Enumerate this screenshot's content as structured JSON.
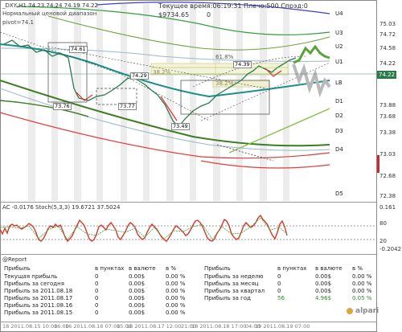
{
  "header": {
    "symbol_line": "_DXY,H1  74.23 74.24 74.19 74.22",
    "indicator_title": "Нормальный ценовой диапазон",
    "pivot_label": "pivot=74.1",
    "time_label": "Текущее время:06:19:31 Плечо:500  Спрэд:0",
    "balance": "$9734.65",
    "zero": "0"
  },
  "levels": {
    "right_codes": [
      "U4",
      "U3",
      "U2",
      "U1",
      "LB",
      "D1",
      "D2",
      "D3",
      "D4",
      "D5"
    ],
    "fib_618": "61.8%",
    "fib_382a": "38.2%",
    "fib_382b": "38.2%"
  },
  "price_axis": {
    "ticks": [
      "75.03",
      "74.72",
      "74.58",
      "74.22",
      "73.88",
      "73.68",
      "73.38",
      "73.03",
      "72.68",
      "72.38"
    ],
    "current_price": "74.22",
    "current_color": "#2b7a4b"
  },
  "annotations": {
    "labels": [
      "74.61",
      "73.76",
      "74.29",
      "73.77",
      "73.49",
      "74.39"
    ]
  },
  "oscillator": {
    "header": "AC -0.0176  Stoch(5,3,3) 19.6721 37.5024",
    "ticks": [
      "0.161",
      "80",
      "20",
      "-0.2042"
    ]
  },
  "report": {
    "title": "@Report",
    "left_headers": [
      "Прибыль",
      "в пунктах",
      "в валюте",
      "в %"
    ],
    "left_rows": [
      [
        "Текущая прибыль",
        "0",
        "0.00$",
        "0.00 %"
      ],
      [
        "Прибыль за сегодня",
        "0",
        "0.00$",
        "0.00 %"
      ],
      [
        "Прибыль за 2011.08.18",
        "0",
        "0.00$",
        "0.00 %"
      ],
      [
        "Прибыль за 2011.08.17",
        "0",
        "0.00$",
        "0.00 %"
      ],
      [
        "Прибыль за 2011.08.16",
        "0",
        "0.00$",
        "0.00 %"
      ],
      [
        "Прибыль за 2011.08.15",
        "0",
        "0.00$",
        "0.00 %"
      ]
    ],
    "right_headers": [
      "Прибыль",
      "в пунктах",
      "в валюте",
      "в %"
    ],
    "right_rows": [
      [
        "Прибыль за неделю",
        "0",
        "0.00$",
        "0.00 %"
      ],
      [
        "Прибыль за месяц",
        "0",
        "0.00$",
        "0.00 %"
      ],
      [
        "Прибыль за квартал",
        "0",
        "0.00$",
        "0.00 %"
      ],
      [
        "Прибыль за год",
        "56",
        "4.96$",
        "0.05 %"
      ]
    ]
  },
  "brand": "alpari",
  "time_axis": [
    "18 2011.08.15 10:00",
    "16:00",
    "16 2011.08.16 07:00",
    "15:00",
    "18 2011.08.17 12:00",
    "21:00",
    "18 2011.08.18 17:00",
    "04:00",
    "19 2011.08.19 07:00"
  ]
}
